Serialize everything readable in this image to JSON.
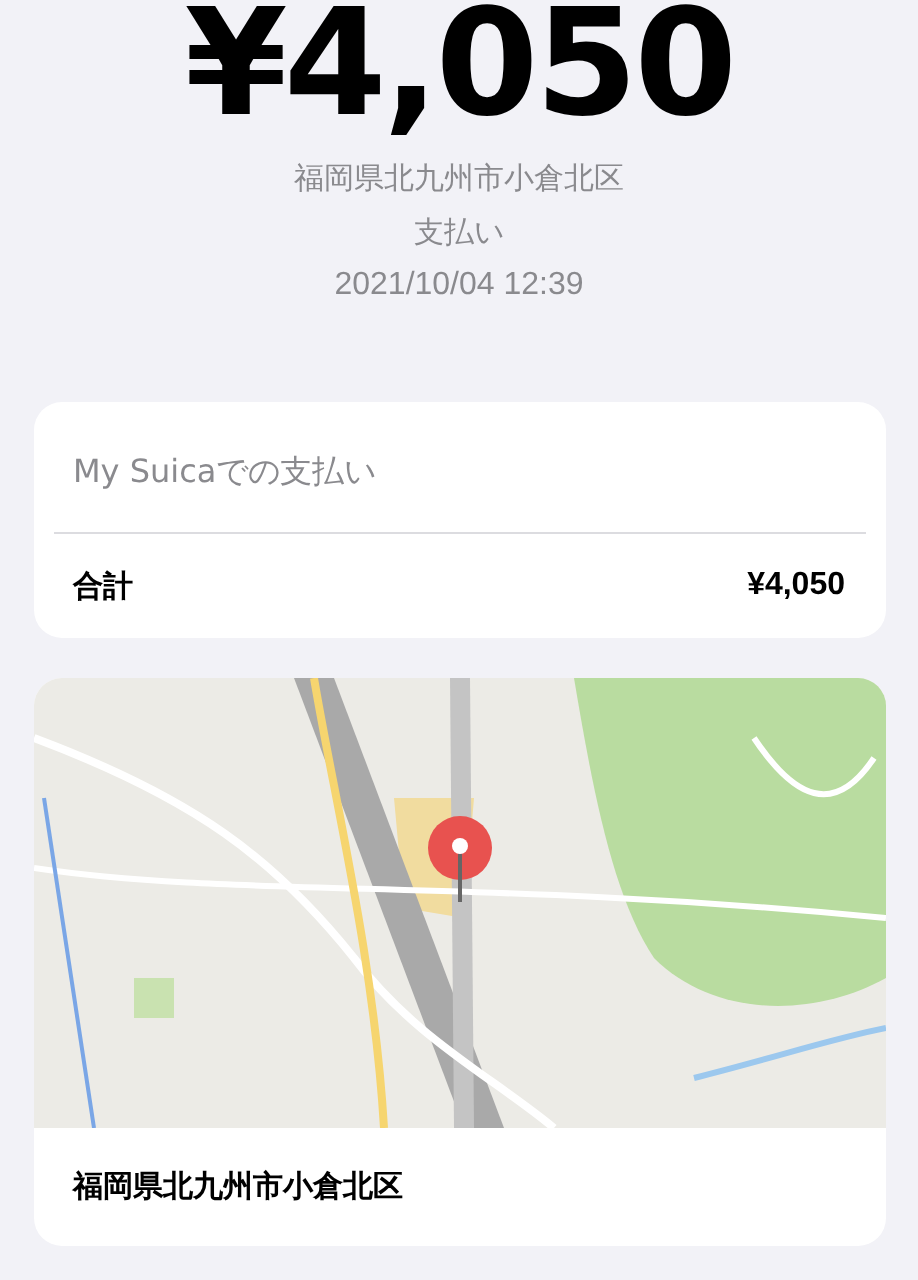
{
  "amount": "¥4,050",
  "location": "福岡県北九州市小倉北区",
  "type": "支払い",
  "datetime": "2021/10/04 12:39",
  "payment_card": {
    "title": "My Suicaでの支払い",
    "total_label": "合計",
    "total_value": "¥4,050"
  },
  "map_card": {
    "address": "福岡県北九州市小倉北区"
  }
}
